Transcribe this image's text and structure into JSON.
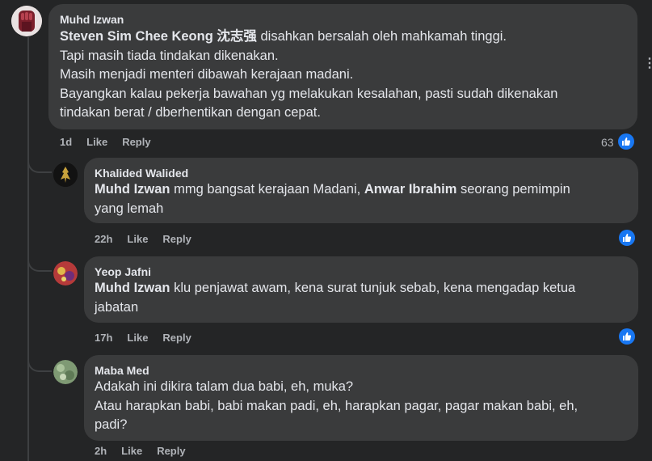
{
  "comments": [
    {
      "author": "Muhd Izwan",
      "mention": "Steven Sim Chee Keong 沈志强",
      "lines": [
        " disahkan bersalah oleh mahkamah tinggi.",
        "Tapi masih tiada tindakan dikenakan.",
        "Masih menjadi menteri dibawah kerajaan madani.",
        "Bayangkan kalau pekerja bawahan yg melakukan kesalahan, pasti sudah dikenakan",
        "tindakan berat / dberhentikan dengan cepat."
      ],
      "time": "1d",
      "like_label": "Like",
      "reply_label": "Reply",
      "reaction_count": "63"
    },
    {
      "author": "Khalided Walided",
      "mention1": "Muhd Izwan",
      "text1": " mmg bangsat kerajaan Madani, ",
      "mention2": "Anwar Ibrahim",
      "text2": " seorang pemimpin",
      "line2": "yang lemah",
      "time": "22h",
      "like_label": "Like",
      "reply_label": "Reply"
    },
    {
      "author": "Yeop Jafni",
      "mention": "Muhd Izwan",
      "text1": " klu penjawat awam, kena surat tunjuk sebab, kena mengadap ketua",
      "line2": "jabatan",
      "time": "17h",
      "like_label": "Like",
      "reply_label": "Reply"
    },
    {
      "author": "Maba Med",
      "lines": [
        "Adakah ini dikira talam dua babi, eh, muka?",
        "Atau harapkan babi, babi makan padi, eh, harapkan pagar, pagar makan babi, eh,",
        "padi?"
      ],
      "time": "2h",
      "like_label": "Like",
      "reply_label": "Reply"
    }
  ],
  "more_label": "···",
  "colors": {
    "bg": "#242526",
    "bubble": "#3a3b3c",
    "accent": "#1877f2"
  }
}
